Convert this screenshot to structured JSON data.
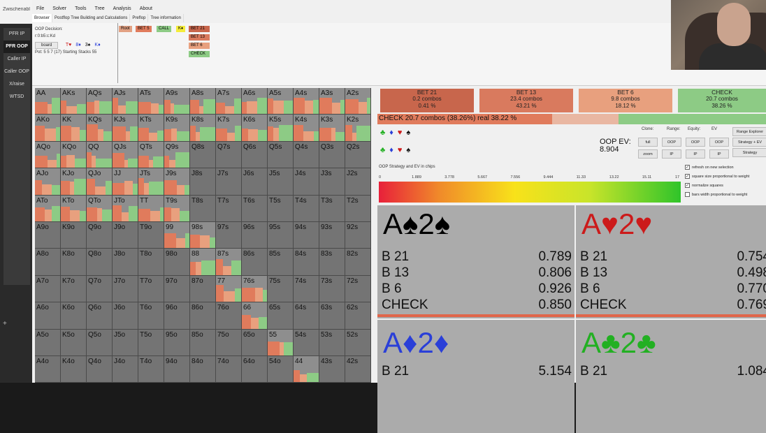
{
  "sidebar": {
    "app_title": "Zwischenabl",
    "items": [
      "PFR IP",
      "PFR OOP",
      "Caller IP",
      "Caller OOP",
      "X/raise",
      "WTSD"
    ],
    "active_index": 1,
    "add_symbol": "+"
  },
  "menu": [
    "File",
    "Solver",
    "Tools",
    "Tree",
    "Analysis",
    "About"
  ],
  "tabs": [
    "Browser",
    "Postflop Tree Building and Calculations",
    "Preflop",
    "Tree information"
  ],
  "info": {
    "line1": "OOP Decision:",
    "line2": "r:0:b5:c:Kd",
    "board_button": "board",
    "board_cards": [
      "T♥",
      "8♦",
      "3♠",
      "K♦"
    ],
    "pot_line": "Pot: 5 5 7 (17) Starting Stacks 55"
  },
  "tree_nodes": [
    {
      "label": "Root",
      "color": "#e2a183"
    },
    {
      "label": "BET 5",
      "color": "#e07b5c"
    },
    {
      "label": "CALL",
      "color": "#8dcb85"
    },
    {
      "label": "K♦",
      "color": "#f4ec3a"
    },
    {
      "label": "BET 21",
      "color": "#c8664c"
    },
    {
      "label": "BET 13",
      "color": "#d97a5e"
    },
    {
      "label": "BET 6",
      "color": "#e8a07e"
    },
    {
      "label": "CHECK",
      "color": "#8dcb85"
    }
  ],
  "matrix_rows": [
    [
      "AA",
      "AKs",
      "AQs",
      "AJs",
      "ATs",
      "A9s",
      "A8s",
      "A7s",
      "A6s",
      "A5s",
      "A4s",
      "A3s",
      "A2s"
    ],
    [
      "AKo",
      "KK",
      "KQs",
      "KJs",
      "KTs",
      "K9s",
      "K8s",
      "K7s",
      "K6s",
      "K5s",
      "K4s",
      "K3s",
      "K2s"
    ],
    [
      "AQo",
      "KQo",
      "QQ",
      "QJs",
      "QTs",
      "Q9s",
      "Q8s",
      "Q7s",
      "Q6s",
      "Q5s",
      "Q4s",
      "Q3s",
      "Q2s"
    ],
    [
      "AJo",
      "KJo",
      "QJo",
      "JJ",
      "JTs",
      "J9s",
      "J8s",
      "J7s",
      "J6s",
      "J5s",
      "J4s",
      "J3s",
      "J2s"
    ],
    [
      "ATo",
      "KTo",
      "QTo",
      "JTo",
      "TT",
      "T9s",
      "T8s",
      "T7s",
      "T6s",
      "T5s",
      "T4s",
      "T3s",
      "T2s"
    ],
    [
      "A9o",
      "K9o",
      "Q9o",
      "J9o",
      "T9o",
      "99",
      "98s",
      "97s",
      "96s",
      "95s",
      "94s",
      "93s",
      "92s"
    ],
    [
      "A8o",
      "K8o",
      "Q8o",
      "J8o",
      "T8o",
      "98o",
      "88",
      "87s",
      "86s",
      "85s",
      "84s",
      "83s",
      "82s"
    ],
    [
      "A7o",
      "K7o",
      "Q7o",
      "J7o",
      "T7o",
      "97o",
      "87o",
      "77",
      "76s",
      "75s",
      "74s",
      "73s",
      "72s"
    ],
    [
      "A6o",
      "K6o",
      "Q6o",
      "J6o",
      "T6o",
      "96o",
      "86o",
      "76o",
      "66",
      "65s",
      "64s",
      "63s",
      "62s"
    ],
    [
      "A5o",
      "K5o",
      "Q5o",
      "J5o",
      "T5o",
      "95o",
      "85o",
      "75o",
      "65o",
      "55",
      "54s",
      "53s",
      "52s"
    ],
    [
      "A4o",
      "K4o",
      "Q4o",
      "J4o",
      "T4o",
      "94o",
      "84o",
      "74o",
      "64o",
      "54o",
      "44",
      "43s",
      "42s"
    ]
  ],
  "actions": [
    {
      "label": "BET 21",
      "combos": "0.2 combos",
      "pct": "0.41 %",
      "color": "#c8664c"
    },
    {
      "label": "BET 13",
      "combos": "23.4 combos",
      "pct": "43.21 %",
      "color": "#d97a5e"
    },
    {
      "label": "BET 6",
      "combos": "9.8 combos",
      "pct": "18.12 %",
      "color": "#e8a07e"
    },
    {
      "label": "CHECK",
      "combos": "20.7 combos",
      "pct": "38.26 %",
      "color": "#8dcb85"
    }
  ],
  "selection_line": "CHECK  20.7 combos (38.26%) real  38.22 %",
  "suits_row": [
    "♣",
    "♦",
    "♥",
    "♠"
  ],
  "oop_ev": {
    "label": "OOP EV:",
    "value": "8.904"
  },
  "controls": {
    "headers": [
      "Clone:",
      "Range:",
      "Equity:",
      "EV"
    ],
    "clone_buttons": [
      "full",
      "zoom"
    ],
    "range_buttons": [
      "OOP",
      "IP"
    ],
    "equity_buttons": [
      "OOP",
      "IP"
    ],
    "ev_buttons": [
      "OOP",
      "IP"
    ],
    "wide_buttons": [
      "Range Explorer",
      "Strategy + EV",
      "Strategy"
    ]
  },
  "checkboxes": [
    {
      "label": "refresh on new selection",
      "checked": true
    },
    {
      "label": "square size proportional to weight",
      "checked": true
    },
    {
      "label": "normalize squares",
      "checked": true
    },
    {
      "label": "bars width proportional to weight",
      "checked": false
    }
  ],
  "strategy_title": "OOP Strategy and EV in chips",
  "ev_ticks": [
    "0",
    "1.889",
    "3.778",
    "5.667",
    "7.556",
    "9.444",
    "11.33",
    "13.22",
    "15.11",
    "17"
  ],
  "combos": [
    {
      "rank1": "A",
      "suit1": "♠",
      "rank2": "2",
      "suit2": "♠",
      "color": "#000000",
      "rows": [
        {
          "a": "B 21",
          "v": "0.789"
        },
        {
          "a": "B 13",
          "v": "0.806"
        },
        {
          "a": "B 6",
          "v": "0.926"
        },
        {
          "a": "CHECK",
          "v": "0.850"
        }
      ]
    },
    {
      "rank1": "A",
      "suit1": "♥",
      "rank2": "2",
      "suit2": "♥",
      "color": "#cc1a1a",
      "rows": [
        {
          "a": "B 21",
          "v": "0.754"
        },
        {
          "a": "B 13",
          "v": "0.498"
        },
        {
          "a": "B 6",
          "v": "0.770"
        },
        {
          "a": "CHECK",
          "v": "0.769"
        }
      ]
    },
    {
      "rank1": "A",
      "suit1": "♦",
      "rank2": "2",
      "suit2": "♦",
      "color": "#2a3fd8",
      "rows": [
        {
          "a": "B 21",
          "v": "5.154"
        }
      ]
    },
    {
      "rank1": "A",
      "suit1": "♣",
      "rank2": "2",
      "suit2": "♣",
      "color": "#22b022",
      "rows": [
        {
          "a": "B 21",
          "v": "1.084"
        }
      ]
    }
  ],
  "colors": {
    "bet_dark": "#c8664c",
    "bet_mid": "#d97a5e",
    "bet_light": "#e8a07e",
    "check": "#8dcb85",
    "cell_bg": "#747474"
  }
}
